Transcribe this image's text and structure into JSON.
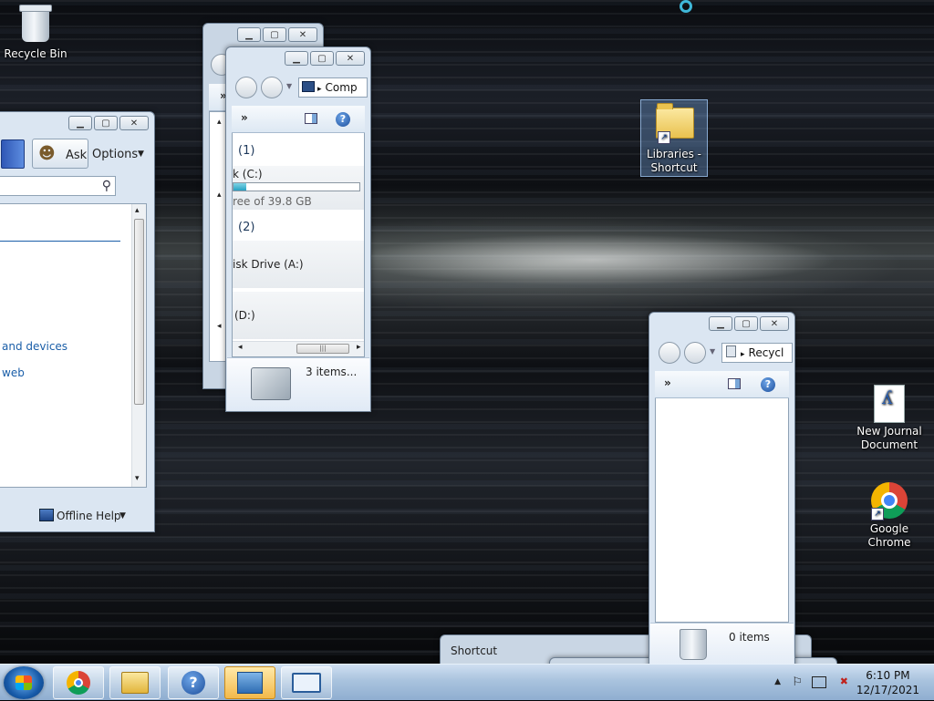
{
  "desktop": {
    "icons": {
      "recycle_bin": "Recycle Bin",
      "libraries": "Libraries - Shortcut",
      "journal": "New Journal Document",
      "chrome": "Google Chrome"
    }
  },
  "help_window": {
    "ask": "Ask",
    "options": "Options",
    "link1": "and devices",
    "link2": "web",
    "offline_help": "Offline Help"
  },
  "computer_window": {
    "address": "Comp",
    "group1": "(1)",
    "drive_c": "k (C:)",
    "drive_c_free": "ree of 39.8 GB",
    "drive_c_used_fraction": 0.1,
    "group2": "(2)",
    "floppy": "isk Drive (A:)",
    "drive_d": "(D:)",
    "items": "3 items..."
  },
  "recycle_window": {
    "address": "Recycl",
    "items": "0 items"
  },
  "shortcut_window": {
    "title": "Shortcut"
  },
  "taskbar": {
    "time": "6:10 PM",
    "date": "12/17/2021"
  },
  "glyphs": {
    "min": "▁",
    "max": "▢",
    "close": "✕",
    "chevron": "»",
    "dropdown": "▼",
    "arrow_right": "▸",
    "arrow_left": "◂",
    "arrow_up": "▴",
    "arrow_down": "▾",
    "help": "?",
    "search": "⚲",
    "flag": "⚐",
    "speaker_mute": "✖",
    "tray_up": "▲",
    "grip": "≡",
    "hgrip": "|||"
  }
}
